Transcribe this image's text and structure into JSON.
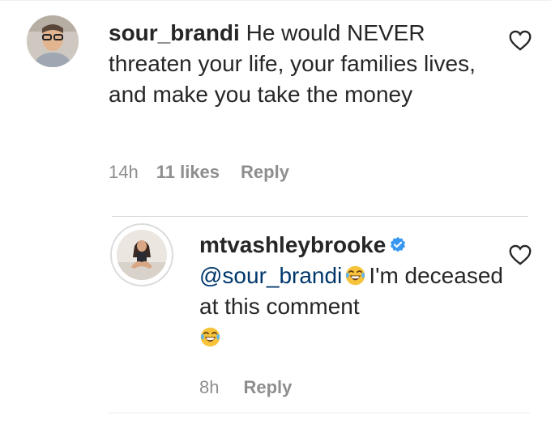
{
  "comment": {
    "username": "sour_brandi",
    "text": "He would NEVER threaten your life, your families lives, and make you take the money",
    "time": "14h",
    "likes": "11 likes",
    "reply_label": "Reply"
  },
  "reply": {
    "username": "mtvashleybrooke",
    "mention": "@sour_brandi",
    "text_part1": "I'm deceased at this comment",
    "time": "8h",
    "reply_label": "Reply"
  },
  "icons": {
    "like": "heart-outline-icon",
    "verified": "verified-badge-icon",
    "emoji": "face-with-tears-of-joy-emoji"
  },
  "colors": {
    "text": "#262626",
    "meta": "#8e8e8e",
    "mention": "#00376b",
    "verified": "#3897f0"
  }
}
